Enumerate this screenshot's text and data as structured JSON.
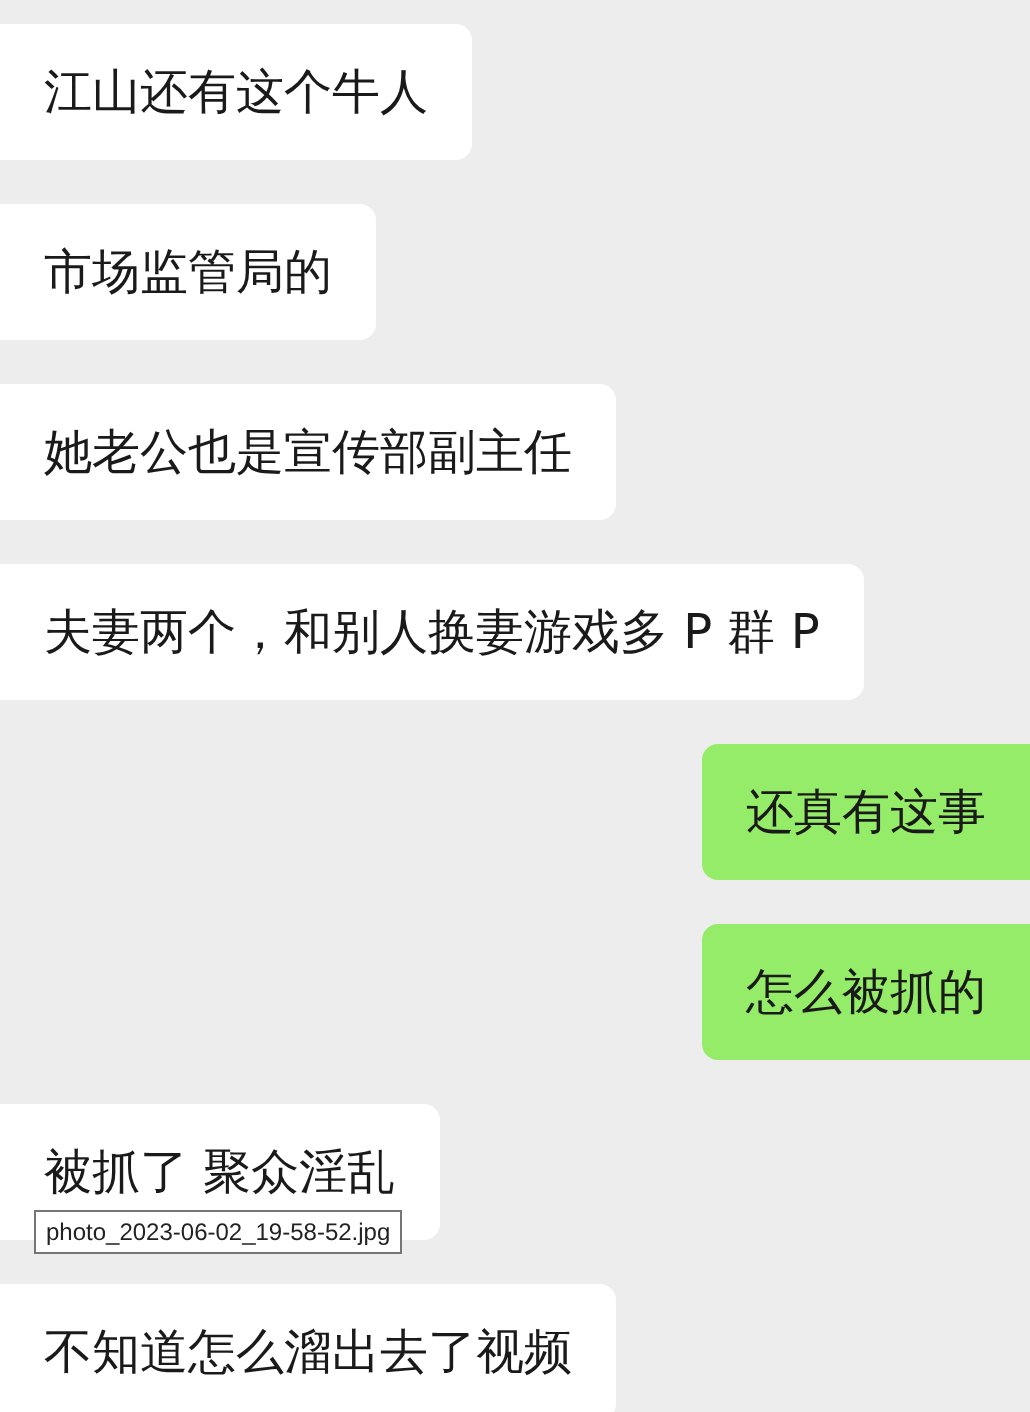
{
  "messages": [
    {
      "kind": "received",
      "text": "江山还有这个牛人"
    },
    {
      "kind": "received",
      "text": "市场监管局的"
    },
    {
      "kind": "received",
      "text": "她老公也是宣传部副主任"
    },
    {
      "kind": "received",
      "text": "夫妻两个，和别人换妻游戏多 P 群 P"
    },
    {
      "kind": "sent",
      "text": "还真有这事"
    },
    {
      "kind": "sent",
      "text": "怎么被抓的"
    },
    {
      "kind": "received",
      "text": "被抓了 聚众淫乱",
      "tooltip": "photo_2023-06-02_19-58-52.jpg"
    },
    {
      "kind": "received",
      "text": "不知道怎么溜出去了视频"
    }
  ]
}
